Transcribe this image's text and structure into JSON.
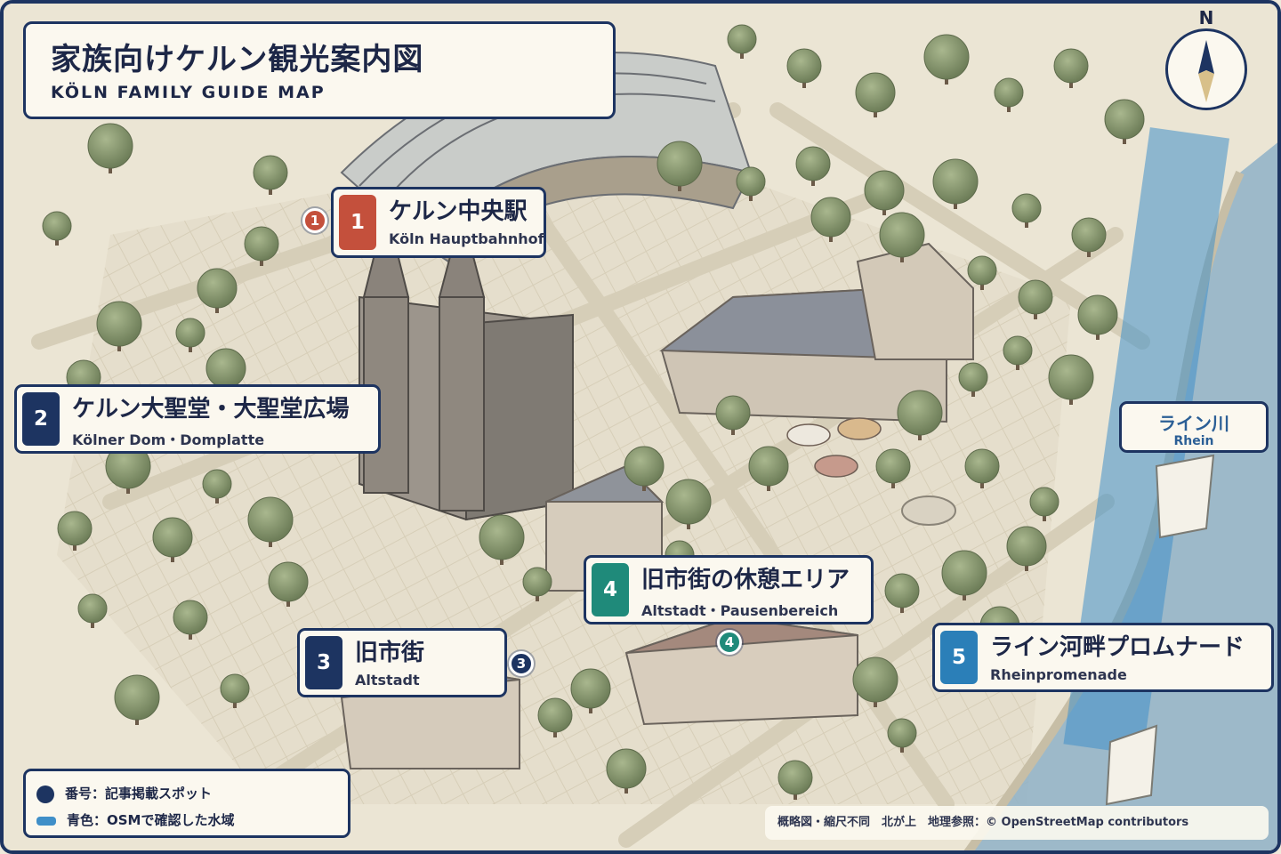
{
  "title": {
    "jp": "家族向けケルン観光案内図",
    "de": "KÖLN FAMILY GUIDE MAP"
  },
  "colors": {
    "navy": "#1d3461",
    "red": "#c4503c",
    "teal": "#1f8a7a",
    "blue": "#2b7fb8",
    "water": "#3f8fc8"
  },
  "spots": [
    {
      "number": "1",
      "jp": "ケルン中央駅",
      "de": "Köln Hauptbahnhof",
      "color": "#c4503c"
    },
    {
      "number": "2",
      "jp": "ケルン大聖堂・大聖堂広場",
      "de": "Kölner Dom・Domplatte",
      "color": "#1d3461"
    },
    {
      "number": "3",
      "jp": "旧市街",
      "de": "Altstadt",
      "color": "#1d3461"
    },
    {
      "number": "4",
      "jp": "旧市街の休憩エリア",
      "de": "Altstadt・Pausenbereich",
      "color": "#1f8a7a"
    },
    {
      "number": "5",
      "jp": "ライン河畔プロムナード",
      "de": "Rheinpromenade",
      "color": "#2b7fb8"
    }
  ],
  "pins": [
    "1",
    "3",
    "4"
  ],
  "river": {
    "jp": "ライン川",
    "de": "Rhein"
  },
  "compass": {
    "north": "N",
    "icon": "compass-icon"
  },
  "legend": {
    "number_label": "番号：記事掲載スポット",
    "water_label": "青色：OSMで確認した水域"
  },
  "credit": "概略図・縮尺不同　北が上　地理参照：© OpenStreetMap contributors"
}
